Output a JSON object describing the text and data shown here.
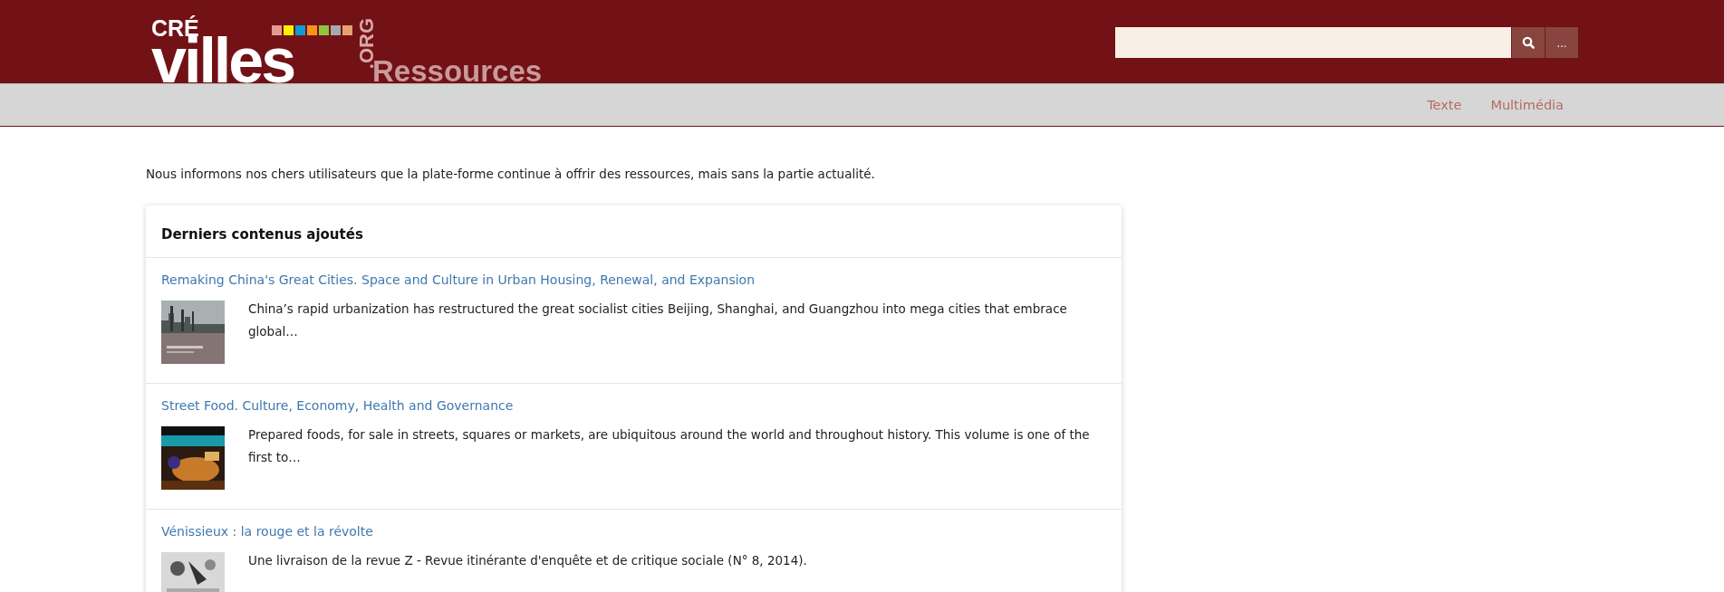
{
  "header": {
    "logo": {
      "top": "CRÉ",
      "main": "villes",
      "suffix": ".ORG"
    },
    "section_title": "Ressources",
    "search": {
      "more_button": "..."
    }
  },
  "nav": [
    {
      "label": "Texte"
    },
    {
      "label": "Multimédia"
    }
  ],
  "notice": "Nous informons nos chers utilisateurs que la plate-forme continue à offrir des ressources, mais sans la partie actualité.",
  "latest": {
    "title": "Derniers contenus ajoutés",
    "items": [
      {
        "title": "Remaking China's Great Cities. Space and Culture in Urban Housing, Renewal, and Expansion",
        "summary": "China’s rapid urbanization has restructured the great socialist cities Beijing, Shanghai, and Guangzhou into mega cities that embrace global…"
      },
      {
        "title": "Street Food. Culture, Economy, Health and Governance",
        "summary": "Prepared foods, for sale in streets, squares or markets, are ubiquitous around the world and throughout history. This volume is one of the first to…"
      },
      {
        "title": "Vénissieux : la rouge et la révolte",
        "summary": "Une livraison de la revue Z - Revue itinérante d'enquête et de critique sociale (N° 8, 2014)."
      }
    ]
  }
}
